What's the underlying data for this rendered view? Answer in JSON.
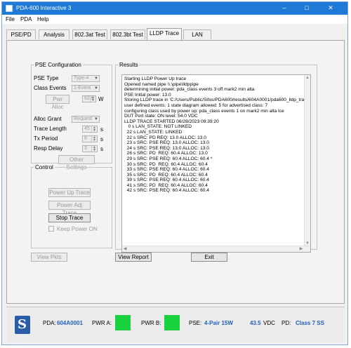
{
  "window": {
    "title": "PDA-600 Interactive 3",
    "controls": {
      "minimize": "–",
      "maximize": "□",
      "close": "✕"
    }
  },
  "menu": {
    "file": "File",
    "pda": "PDA",
    "help": "Help"
  },
  "tabs": [
    {
      "label": "PSE/PD",
      "active": false
    },
    {
      "label": "Analysis",
      "active": false
    },
    {
      "label": "802.3at Test",
      "active": false
    },
    {
      "label": "802.3bt Test",
      "active": false
    },
    {
      "label": "LLDP Trace",
      "active": true
    },
    {
      "label": "LAN",
      "active": false
    }
  ],
  "pse_config": {
    "legend": "PSE Configuration",
    "pse_type_label": "PSE Type",
    "pse_type_value": "Type-4",
    "class_events_label": "Class Events",
    "class_events_value": "1-Event",
    "pwr_alloc_button": "Pwr Alloc",
    "pwr_alloc_value": "62.0",
    "pwr_alloc_unit": "W",
    "alloc_grant_label": "Alloc Grant",
    "alloc_grant_value": "Request",
    "trace_length_label": "Trace Length",
    "trace_length_value": "45",
    "trace_length_unit": "s",
    "tx_period_label": "Tx Period",
    "tx_period_value": "8",
    "tx_period_unit": "s",
    "resp_delay_label": "Resp Delay",
    "resp_delay_value": "3",
    "resp_delay_unit": "s",
    "other_settings_button": "Other Settings"
  },
  "control": {
    "legend": "Control",
    "power_up_trace": "Power Up Trace",
    "power_adj_trace": "Power Adj Trace",
    "stop_trace": "Stop Trace",
    "keep_power_on": "Keep Power ON"
  },
  "results": {
    "legend": "Results",
    "lines": [
      "Starting LLDP Power Up trace",
      "Opened named pipe \\\\.\\pipe\\lldppipe",
      "determining initial power: pda_class events 3 off mark2 min alta",
      "PSE Initial power: 13.0",
      "Storing LLDP trace in 'C:/Users/Public/Sifos/PDA600/results/604A0001/pda600_lldp_trac",
      "user defined events: 1 state diagram allowed: 5 for advertised class: 7",
      "configuring class used by power up: pda_class events 1 on mark2 min alta lce",
      "DUT Port state: ON level: 54.0 VDC",
      "LLDP TRACE STARTED 06/28/2023 09:39:20",
      "   0 s LAN_STATE: NOT LINKED",
      "  22 s LAN_STATE: LINKED",
      "  22 s SRC: PD REQ: 13.0 ALLOC: 13.0",
      "  23 s SRC: PSE REQ: 13.0 ALLOC: 13.0",
      "  24 s SRC: PSE REQ: 13.0 ALLOC: 13.0",
      "  26 s SRC: PD  REQ: 60.4 ALLOC: 13.0",
      "  29 s SRC: PSE REQ: 60.4 ALLOC: 60.4 *",
      "  30 s SRC: PD  REQ: 60.4 ALLOC: 60.4",
      "  33 s SRC: PSE REQ: 60.4 ALLOC: 60.4",
      "  35 s SRC: PD  REQ: 60.4 ALLOC: 60.4",
      "  39 s SRC: PSE REQ: 60.4 ALLOC: 60.4",
      "  41 s SRC: PD  REQ: 60.4 ALLOC: 60.4",
      "  42 s SRC: PSE REQ: 60.4 ALLOC: 60.4"
    ]
  },
  "bottom_buttons": {
    "view_pkts": "View Pkts",
    "view_report": "View Report",
    "exit": "Exit"
  },
  "status": {
    "pda_label": "PDA:",
    "pda_value": "604A0001",
    "pwr_a_label": "PWR A:",
    "pwr_a_color": "#19d23d",
    "pwr_b_label": "PWR B:",
    "pwr_b_color": "#19d23d",
    "pse_label": "PSE:",
    "pse_value": "4-Pair 15W",
    "voltage_value": "43.5",
    "voltage_unit": "VDC",
    "pd_label": "PD:",
    "pd_value": "Class  7 SS"
  }
}
